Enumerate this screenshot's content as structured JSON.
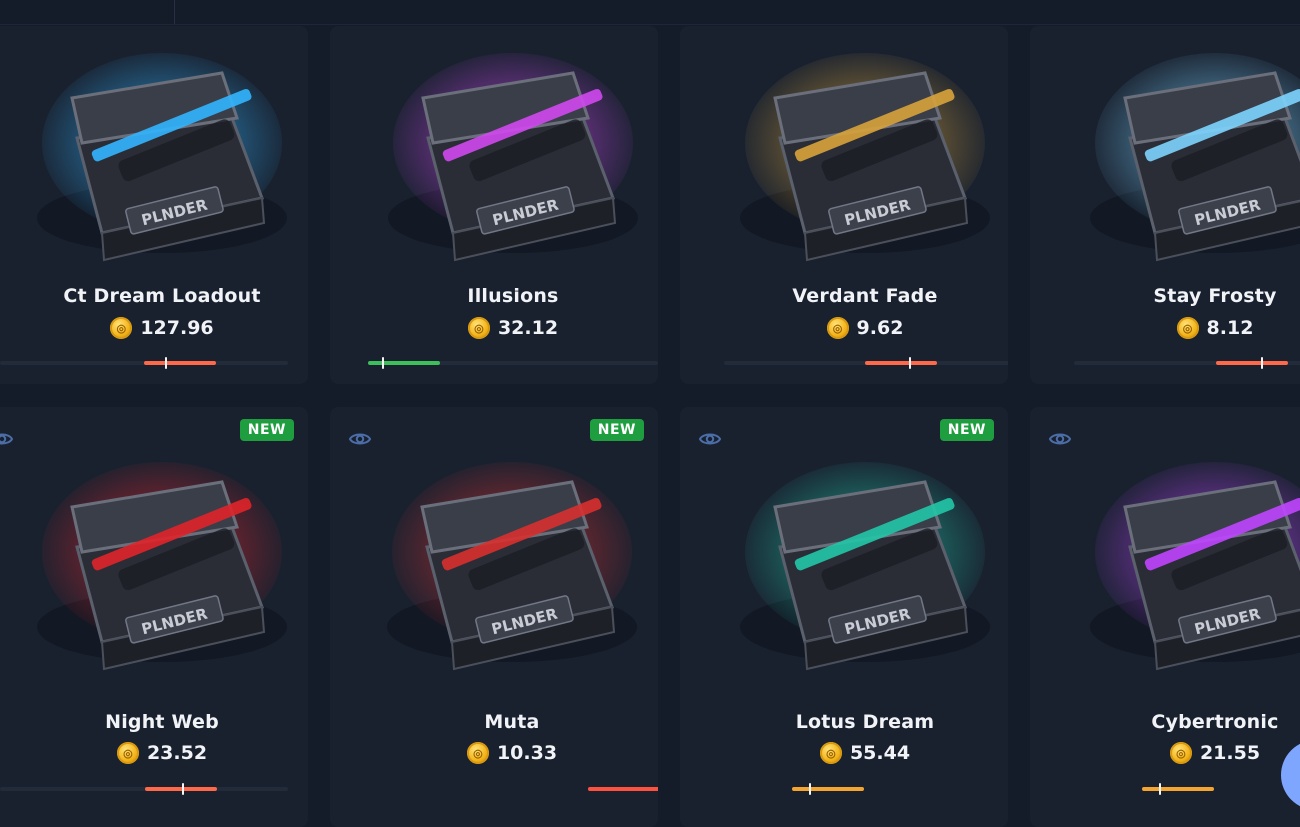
{
  "cases": [
    {
      "name": "Ct Dream Loadout",
      "price": "127.96",
      "is_new": false,
      "theme": "#33b5ff",
      "bar_color": "#ff6848",
      "bar_fill": 0.24,
      "tick_pos": 0.29
    },
    {
      "name": "Illusions",
      "price": "32.12",
      "is_new": false,
      "theme": "#d048f0",
      "bar_color": "#3dbf5c",
      "bar_fill": 0.24,
      "tick_pos": 0.2
    },
    {
      "name": "Verdant Fade",
      "price": "9.62",
      "is_new": false,
      "theme": "#d8a33b",
      "bar_color": "#ff6848",
      "bar_fill": 0.24,
      "tick_pos": 0.61
    },
    {
      "name": "Stay Frosty",
      "price": "8.12",
      "is_new": false,
      "theme": "#7dd4ff",
      "bar_color": "#ff6848",
      "bar_fill": 0.24,
      "tick_pos": 0.62
    },
    {
      "name": "Night Web",
      "price": "23.52",
      "is_new": true,
      "badge": "NEW",
      "theme": "#e0232a",
      "bar_color": "#ff6848",
      "bar_fill": 0.24,
      "tick_pos": 0.52
    },
    {
      "name": "Muta",
      "price": "10.33",
      "is_new": true,
      "badge": "NEW",
      "theme": "#d8302f",
      "bar_color": "#ff5140",
      "bar_fill": 0.24,
      "tick_pos": 0.97
    },
    {
      "name": "Lotus Dream",
      "price": "55.44",
      "is_new": true,
      "badge": "NEW",
      "theme": "#22c7a8",
      "bar_color": "#f3a530",
      "bar_fill": 0.24,
      "tick_pos": 0.24
    },
    {
      "name": "Cybertronic",
      "price": "21.55",
      "is_new": false,
      "theme": "#c045ff",
      "bar_color": "#f3a530",
      "bar_fill": 0.24,
      "tick_pos": 0.24
    }
  ],
  "icons": {
    "currency": "gold-coin-icon",
    "preview": "eye-icon",
    "chat": "chat-bubble-icon"
  }
}
